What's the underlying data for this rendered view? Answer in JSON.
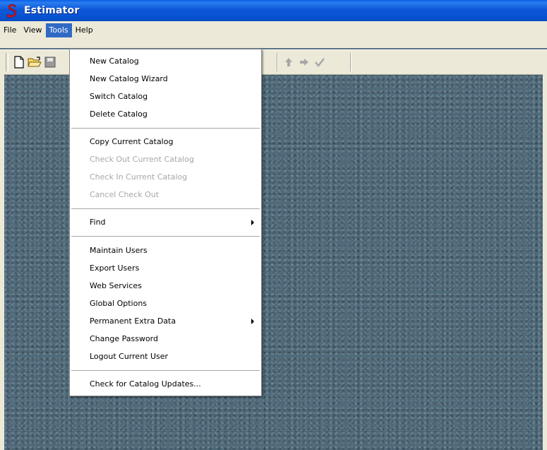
{
  "window": {
    "title": "Estimator"
  },
  "menubar": {
    "items": [
      {
        "label": "File",
        "active": false
      },
      {
        "label": "View",
        "active": false
      },
      {
        "label": "Tools",
        "active": true
      },
      {
        "label": "Help",
        "active": false
      }
    ]
  },
  "toolbar": {
    "buttons": [
      "new-document-icon",
      "open-folder-icon",
      "save-icon",
      "up-arrow-icon",
      "right-arrow-icon",
      "checkmark-icon"
    ]
  },
  "tools_menu": {
    "items": [
      {
        "label": "New Catalog",
        "enabled": true
      },
      {
        "label": "New Catalog Wizard",
        "enabled": true
      },
      {
        "label": "Switch Catalog",
        "enabled": true
      },
      {
        "label": "Delete Catalog",
        "enabled": true
      },
      {
        "label": "Copy Current Catalog",
        "enabled": true
      },
      {
        "label": "Check Out Current Catalog",
        "enabled": false
      },
      {
        "label": "Check In Current Catalog",
        "enabled": false
      },
      {
        "label": "Cancel Check Out",
        "enabled": false
      },
      {
        "label": "Find",
        "enabled": true,
        "submenu": true
      },
      {
        "label": "Maintain Users",
        "enabled": true
      },
      {
        "label": "Export Users",
        "enabled": true
      },
      {
        "label": "Web Services",
        "enabled": true
      },
      {
        "label": "Global Options",
        "enabled": true
      },
      {
        "label": "Permanent Extra Data",
        "enabled": true,
        "submenu": true
      },
      {
        "label": "Change Password",
        "enabled": true
      },
      {
        "label": "Logout Current User",
        "enabled": true
      },
      {
        "label": "Check for Catalog Updates...",
        "enabled": true
      }
    ]
  },
  "colors": {
    "titlebar": "#0a5fe6",
    "menu_highlight": "#316ac5",
    "disabled_text": "#a7a6aa",
    "client_background": "#4f6a7a"
  }
}
